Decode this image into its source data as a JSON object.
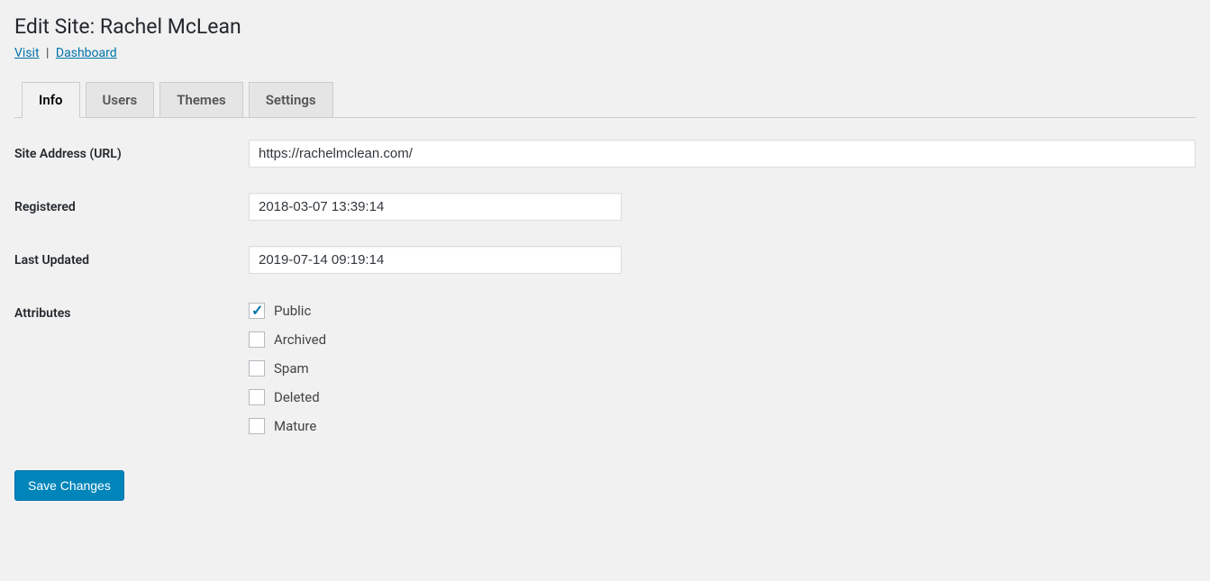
{
  "header": {
    "title": "Edit Site: Rachel McLean",
    "visit_link": "Visit",
    "dashboard_link": "Dashboard"
  },
  "tabs": {
    "info": "Info",
    "users": "Users",
    "themes": "Themes",
    "settings": "Settings"
  },
  "form": {
    "site_address_label": "Site Address (URL)",
    "site_address_value": "https://rachelmclean.com/",
    "registered_label": "Registered",
    "registered_value": "2018-03-07 13:39:14",
    "last_updated_label": "Last Updated",
    "last_updated_value": "2019-07-14 09:19:14",
    "attributes_label": "Attributes"
  },
  "attributes": {
    "public": {
      "label": "Public",
      "checked": true
    },
    "archived": {
      "label": "Archived",
      "checked": false
    },
    "spam": {
      "label": "Spam",
      "checked": false
    },
    "deleted": {
      "label": "Deleted",
      "checked": false
    },
    "mature": {
      "label": "Mature",
      "checked": false
    }
  },
  "submit": {
    "save_label": "Save Changes"
  }
}
